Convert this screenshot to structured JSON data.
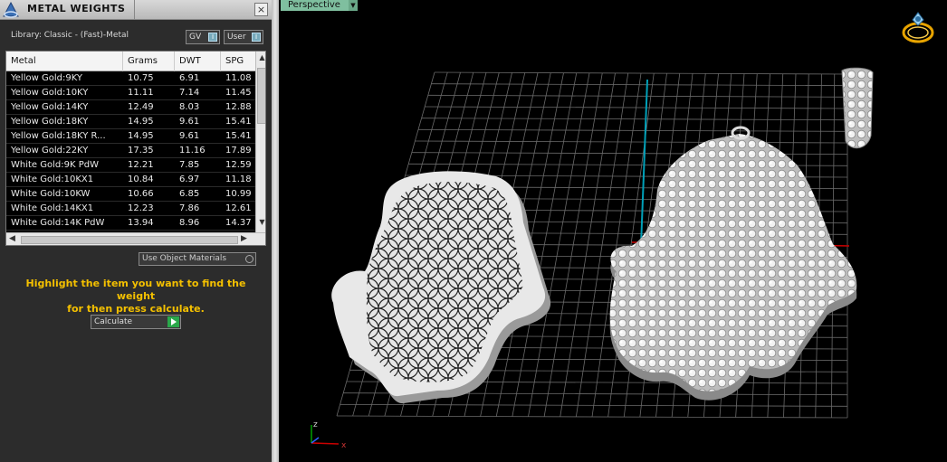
{
  "panel": {
    "title": "METAL WEIGHTS",
    "close_glyph": "×",
    "library_label": "Library: Classic - (Fast)-Metal",
    "toggles": [
      {
        "label": "GV",
        "knob": "I"
      },
      {
        "label": "User",
        "knob": "I"
      }
    ],
    "table": {
      "columns": [
        "Metal",
        "Grams",
        "DWT",
        "SPG"
      ],
      "rows": [
        [
          "Yellow Gold:9KY",
          "10.75",
          "6.91",
          "11.08"
        ],
        [
          "Yellow Gold:10KY",
          "11.11",
          "7.14",
          "11.45"
        ],
        [
          "Yellow Gold:14KY",
          "12.49",
          "8.03",
          "12.88"
        ],
        [
          "Yellow Gold:18KY",
          "14.95",
          "9.61",
          "15.41"
        ],
        [
          "Yellow Gold:18KY R...",
          "14.95",
          "9.61",
          "15.41"
        ],
        [
          "Yellow Gold:22KY",
          "17.35",
          "11.16",
          "17.89"
        ],
        [
          "White Gold:9K PdW",
          "12.21",
          "7.85",
          "12.59"
        ],
        [
          "White Gold:10KX1",
          "10.84",
          "6.97",
          "11.18"
        ],
        [
          "White Gold:10KW",
          "10.66",
          "6.85",
          "10.99"
        ],
        [
          "White Gold:14KX1",
          "12.23",
          "7.86",
          "12.61"
        ],
        [
          "White Gold:14K PdW",
          "13.94",
          "8.96",
          "14.37"
        ]
      ]
    },
    "use_object_materials": "Use Object Materials",
    "hint_line1": "Highlight the item you want to find the weight",
    "hint_line2": "for then press calculate.",
    "calculate_label": "Calculate"
  },
  "viewport": {
    "view_label": "Perspective",
    "axis_labels": {
      "x": "x",
      "z": "z"
    }
  },
  "icons": [
    "app-logo-icon",
    "close-icon",
    "toggle-knob-icon",
    "chevron-up-icon",
    "chevron-down-icon",
    "chevron-left-icon",
    "chevron-right-icon",
    "radio-icon",
    "play-icon",
    "ring-navigator-icon",
    "axis-triad-icon"
  ],
  "colors": {
    "hint": "#f4c000",
    "view_label_bg": "#7fbf9f",
    "calculate_go": "#2aa84a",
    "y_axis": "#00a0b8",
    "x_axis": "#cc0000"
  }
}
